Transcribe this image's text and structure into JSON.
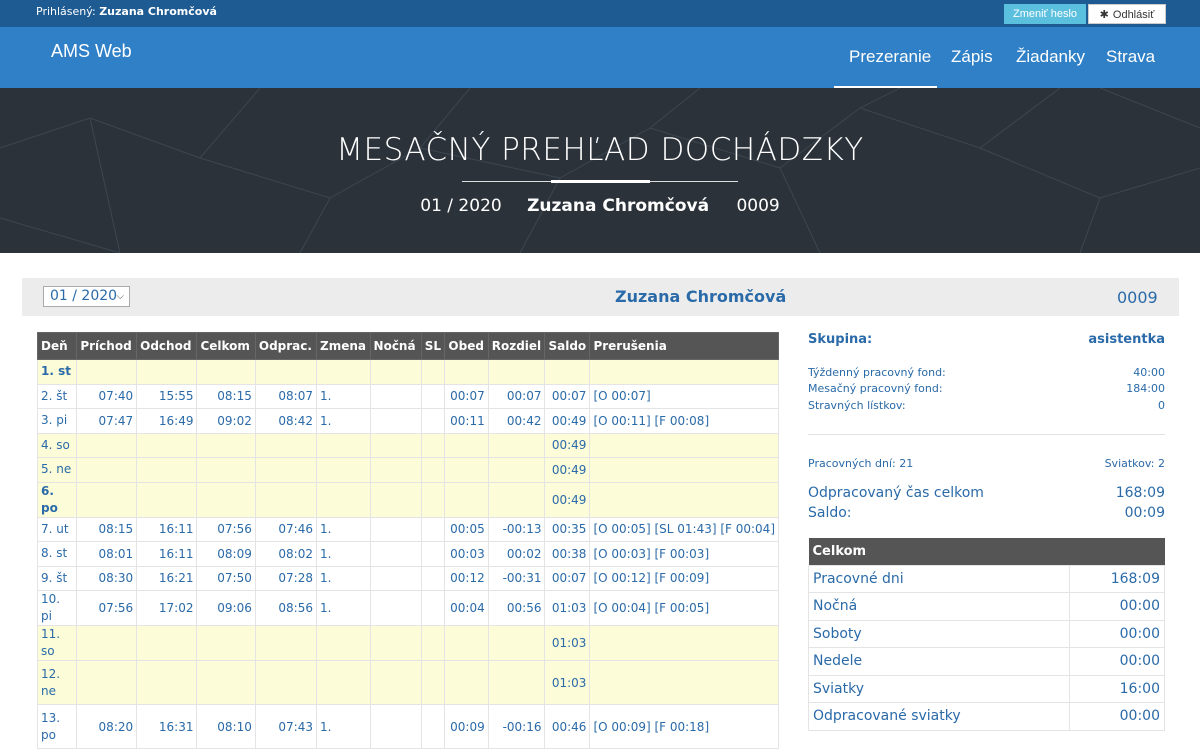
{
  "topbar": {
    "logged_label": "Prihlásený:",
    "user": "Zuzana Chromčová",
    "change_password": "Zmeniť heslo",
    "logout": "Odhlásiť"
  },
  "navbar": {
    "brand": "AMS Web",
    "items": [
      "Prezeranie",
      "Zápis",
      "Žiadanky",
      "Strava"
    ],
    "active": "Prezeranie"
  },
  "hero": {
    "title": "MESAČNÝ PREHĽAD DOCHÁDZKY",
    "period": "01 / 2020",
    "name": "Zuzana Chromčová",
    "code": "0009"
  },
  "header": {
    "month_value": "01 / 2020",
    "name": "Zuzana Chromčová",
    "code": "0009"
  },
  "table": {
    "columns": [
      "Deň",
      "Príchod",
      "Odchod",
      "Celkom",
      "Odprac.",
      "Zmena",
      "Nočná",
      "SL",
      "Obed",
      "Rozdiel",
      "Saldo",
      "Prerušenia"
    ],
    "rows": [
      {
        "day": "1. st",
        "cells": [
          "",
          "",
          "",
          "",
          "",
          "",
          "",
          "",
          "",
          "",
          ""
        ],
        "weekend": true,
        "bold": true
      },
      {
        "day": "2. št",
        "cells": [
          "07:40",
          "15:55",
          "08:15",
          "08:07",
          "1.",
          "",
          "",
          "00:07",
          "00:07",
          "00:07",
          "[O 00:07]"
        ]
      },
      {
        "day": "3. pi",
        "cells": [
          "07:47",
          "16:49",
          "09:02",
          "08:42",
          "1.",
          "",
          "",
          "00:11",
          "00:42",
          "00:49",
          "[O 00:11] [F 00:08]"
        ]
      },
      {
        "day": "4. so",
        "cells": [
          "",
          "",
          "",
          "",
          "",
          "",
          "",
          "",
          "",
          "00:49",
          ""
        ],
        "weekend": true
      },
      {
        "day": "5. ne",
        "cells": [
          "",
          "",
          "",
          "",
          "",
          "",
          "",
          "",
          "",
          "00:49",
          ""
        ],
        "weekend": true
      },
      {
        "day": "6. po",
        "cells": [
          "",
          "",
          "",
          "",
          "",
          "",
          "",
          "",
          "",
          "00:49",
          ""
        ],
        "weekend": true,
        "bold": true
      },
      {
        "day": "7. ut",
        "cells": [
          "08:15",
          "16:11",
          "07:56",
          "07:46",
          "1.",
          "",
          "",
          "00:05",
          "-00:13",
          "00:35",
          "[O 00:05] [SL 01:43] [F 00:04]"
        ]
      },
      {
        "day": "8. st",
        "cells": [
          "08:01",
          "16:11",
          "08:09",
          "08:02",
          "1.",
          "",
          "",
          "00:03",
          "00:02",
          "00:38",
          "[O 00:03] [F 00:03]"
        ]
      },
      {
        "day": "9. št",
        "cells": [
          "08:30",
          "16:21",
          "07:50",
          "07:28",
          "1.",
          "",
          "",
          "00:12",
          "-00:31",
          "00:07",
          "[O 00:12] [F 00:09]"
        ]
      },
      {
        "day": "10. pi",
        "cells": [
          "07:56",
          "17:02",
          "09:06",
          "08:56",
          "1.",
          "",
          "",
          "00:04",
          "00:56",
          "01:03",
          "[O 00:04] [F 00:05]"
        ]
      },
      {
        "day": "11. so",
        "cells": [
          "",
          "",
          "",
          "",
          "",
          "",
          "",
          "",
          "",
          "01:03",
          ""
        ],
        "weekend": true
      },
      {
        "day": "12. ne",
        "cells": [
          "",
          "",
          "",
          "",
          "",
          "",
          "",
          "",
          "",
          "01:03",
          ""
        ],
        "weekend": true,
        "tall": true
      },
      {
        "day": "13. po",
        "cells": [
          "08:20",
          "16:31",
          "08:10",
          "07:43",
          "1.",
          "",
          "",
          "00:09",
          "-00:16",
          "00:46",
          "[O 00:09] [F 00:18]"
        ],
        "tall": true
      }
    ]
  },
  "side": {
    "group_label": "Skupina:",
    "group_value": "asistentka",
    "weekly_fund_label": "Týždenný pracovný fond:",
    "weekly_fund": "40:00",
    "monthly_fund_label": "Mesačný pracovný fond:",
    "monthly_fund": "184:00",
    "meal_label": "Stravných lístkov:",
    "meal": "0",
    "work_days": "Pracovných dní: 21",
    "holidays": "Sviatkov: 2",
    "worked_total_label": "Odpracovaný čas celkom",
    "worked_total": "168:09",
    "saldo_label": "Saldo:",
    "saldo": "00:09"
  },
  "totals": {
    "header": "Celkom",
    "rows": [
      {
        "label": "Pracovné dni",
        "value": "168:09"
      },
      {
        "label": "Nočná",
        "value": "00:00"
      },
      {
        "label": "Soboty",
        "value": "00:00"
      },
      {
        "label": "Nedele",
        "value": "00:00"
      },
      {
        "label": "Sviatky",
        "value": "16:00"
      },
      {
        "label": "Odpracované sviatky",
        "value": "00:00"
      }
    ]
  }
}
